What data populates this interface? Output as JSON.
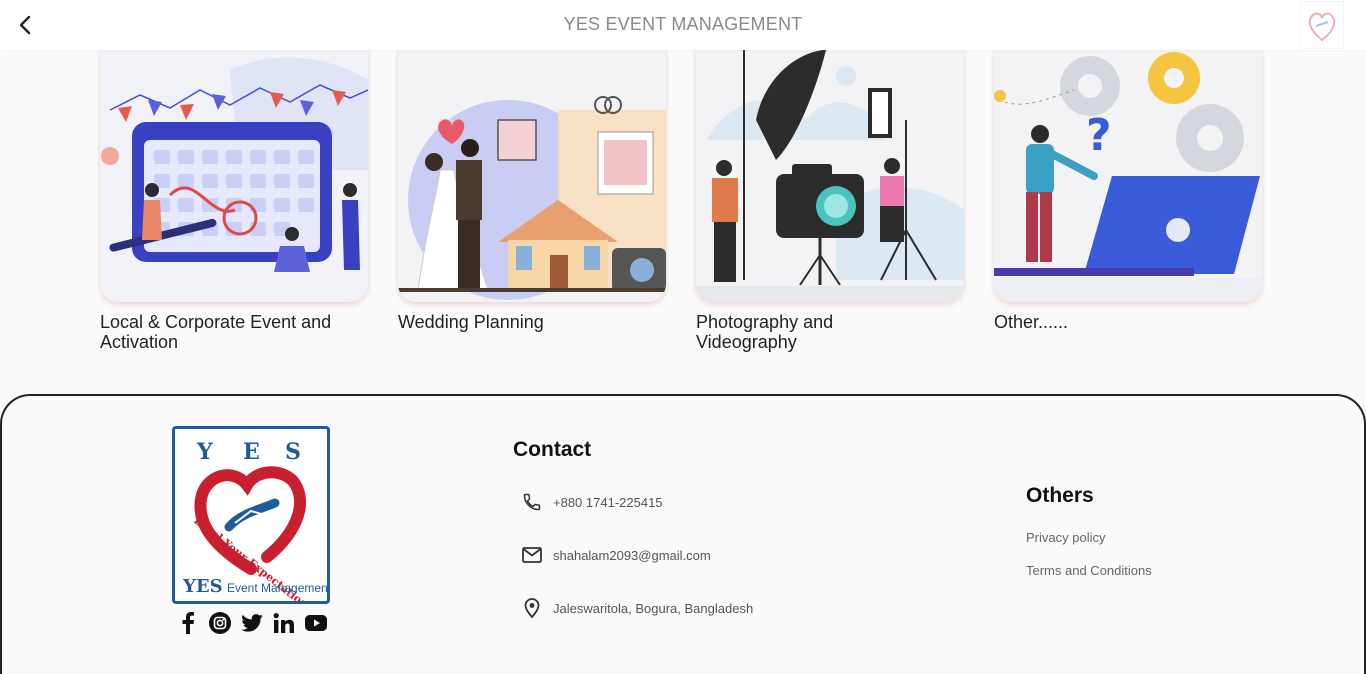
{
  "appbar": {
    "title": "YES EVENT MANAGEMENT",
    "back_icon": "arrow-back-icon",
    "logo": "yes-logo"
  },
  "services": [
    {
      "label": "Local & Corporate Event and Activation",
      "illustration": "calendar-event-illustration"
    },
    {
      "label": "Wedding Planning",
      "illustration": "wedding-couple-illustration"
    },
    {
      "label": "Photography and Videography",
      "illustration": "photo-studio-illustration"
    },
    {
      "label": "Other......",
      "illustration": "laptop-gears-illustration"
    }
  ],
  "footer": {
    "logo": {
      "letters": [
        "Y",
        "E",
        "S"
      ],
      "tagline": "Excel Your Expectation",
      "brand_main": "YES",
      "brand_rest": "Event Management"
    },
    "social": [
      "facebook-icon",
      "instagram-icon",
      "twitter-icon",
      "linkedin-icon",
      "youtube-icon"
    ],
    "contact": {
      "title": "Contact",
      "phone": "+880 1741-225415",
      "email": "shahalam2093@gmail.com",
      "address": "Jaleswaritola, Bogura, Bangladesh"
    },
    "others": {
      "title": "Others",
      "links": [
        "Privacy policy",
        "Terms and Conditions"
      ]
    }
  },
  "colors": {
    "brand_blue": "#1f5c9c",
    "brand_red": "#c8202f",
    "title_gray": "#8a8a8a"
  }
}
